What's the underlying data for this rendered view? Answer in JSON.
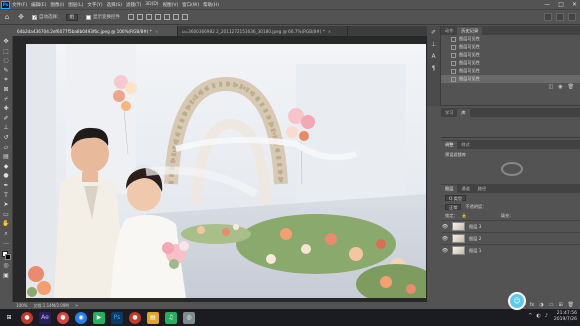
{
  "app": {
    "logo_text": "Ps"
  },
  "menu": {
    "items": [
      "文件(F)",
      "编辑(E)",
      "图像(I)",
      "图层(L)",
      "文字(Y)",
      "选择(S)",
      "滤镜(T)",
      "3D(D)",
      "视图(V)",
      "窗口(W)",
      "帮助(H)"
    ]
  },
  "window_controls": {
    "minimize": "—",
    "maximize": "□",
    "close": "✕"
  },
  "options_bar": {
    "auto_select_label": "自动选择：",
    "auto_select_target": "组",
    "show_transform_label": "显示变换控件"
  },
  "tabs": [
    {
      "label": "64b2da436704.2ef6077f5ba8b0493f6c.jpeg @ 100%(RGB/8#) *",
      "close": "×",
      "active": true
    },
    {
      "label": "u=3600366982 2_2011272151636_30180.jpeg @ 66.7%(RGB/8#) *",
      "close": "×",
      "active": false
    }
  ],
  "status_bar": {
    "zoom": "100%",
    "doc_info": "文档:1.14M/2.09M",
    "arrow": ">"
  },
  "panels": {
    "history": {
      "tabs": [
        "动作",
        "历史记录"
      ],
      "rows": [
        "图层可见性",
        "图层可见性",
        "图层可见性",
        "图层可见性",
        "图层可见性",
        "图层可见性"
      ],
      "selected_index": 5
    },
    "properties": {
      "tabs": [
        "学习",
        "库"
      ]
    },
    "adjustments": {
      "tabs": [
        "调整",
        "样式"
      ],
      "subtitle": "预设滤镜库"
    },
    "layers": {
      "tabs": [
        "图层",
        "通道",
        "路径"
      ],
      "kind_label": "Q 类型",
      "blend_mode": "正常",
      "opacity_label": "不透明度：",
      "lock_label": "锁定：",
      "fill_label": "填充：",
      "items": [
        {
          "name": "图层 3",
          "visible": true,
          "selected": false
        },
        {
          "name": "图层 2",
          "visible": true,
          "selected": false
        },
        {
          "name": "图层 1",
          "visible": true,
          "selected": false
        }
      ]
    }
  },
  "taskbar": {
    "time": "21:47:56",
    "date": "2019/7/26",
    "apps": [
      {
        "name": "windows-start",
        "glyph": "⊞",
        "color": "#1b1b22"
      },
      {
        "name": "record",
        "glyph": "●",
        "color": "#c0392b"
      },
      {
        "name": "after-effects",
        "glyph": "Ae",
        "color": "#2a1f5e"
      },
      {
        "name": "ime",
        "glyph": "●",
        "color": "#d64545"
      },
      {
        "name": "browser",
        "glyph": "◉",
        "color": "#2b7de9"
      },
      {
        "name": "media",
        "glyph": "▶",
        "color": "#27ae60"
      },
      {
        "name": "photoshop",
        "glyph": "Ps",
        "color": "#0a3b66"
      },
      {
        "name": "red-app",
        "glyph": "●",
        "color": "#c0392b"
      },
      {
        "name": "folder",
        "glyph": "▤",
        "color": "#e1a52c"
      },
      {
        "name": "music",
        "glyph": "♫",
        "color": "#27ae60"
      },
      {
        "name": "camera",
        "glyph": "◎",
        "color": "#7f8c8d"
      }
    ]
  }
}
